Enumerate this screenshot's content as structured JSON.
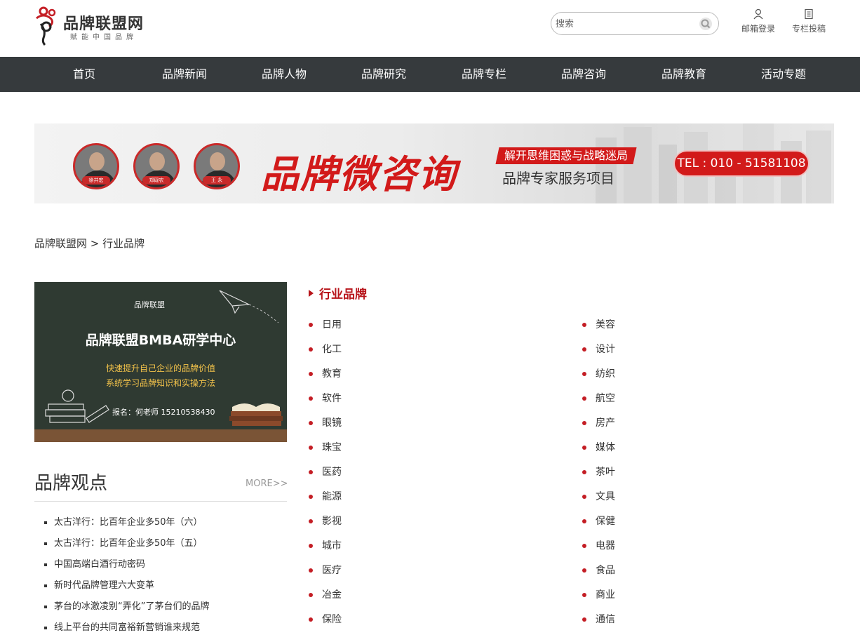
{
  "header": {
    "logo_title": "品牌联盟网",
    "logo_sub": "赋能中国品牌",
    "search_placeholder": "搜索",
    "login_label": "邮箱登录",
    "submit_label": "专栏投稿"
  },
  "nav": [
    "首页",
    "品牌新闻",
    "品牌人物",
    "品牌研究",
    "品牌专栏",
    "品牌咨询",
    "品牌教育",
    "活动专题"
  ],
  "banner": {
    "title": "品牌微咨询",
    "slogan": "解开思维困惑与战略迷局",
    "subtitle": "品牌专家服务项目",
    "tel": "TEL : 010 - 51581108",
    "experts": [
      "徐井宏",
      "郑砚农",
      "王 永"
    ]
  },
  "breadcrumb": "品牌联盟网 > 行业品牌",
  "promo": {
    "logo": "品牌联盟",
    "title": "品牌联盟BMBA研学中心",
    "line1": "快速提升自己企业的品牌价值",
    "line2": "系统学习品牌知识和实操方法",
    "contact": "报名：何老师  15210538430"
  },
  "views": {
    "title": "品牌观点",
    "more": "MORE>>",
    "items": [
      "太古洋行：比百年企业多50年（六）",
      "太古洋行：比百年企业多50年（五）",
      "中国高端白酒行动密码",
      "新时代品牌管理六大变革",
      "茅台的冰激凌别“弄化”了茅台们的品牌",
      "线上平台的共同富裕新营销谁来规范"
    ]
  },
  "categories": {
    "heading": "行业品牌",
    "left": [
      "日用",
      "化工",
      "教育",
      "软件",
      "眼镜",
      "珠宝",
      "医药",
      "能源",
      "影视",
      "城市",
      "医疗",
      "冶金",
      "保险"
    ],
    "right": [
      "美容",
      "设计",
      "纺织",
      "航空",
      "房产",
      "媒体",
      "茶叶",
      "文具",
      "保健",
      "电器",
      "食品",
      "商业",
      "通信"
    ]
  },
  "colors": {
    "accent": "#c41e25",
    "nav_bg": "#363a3d"
  }
}
